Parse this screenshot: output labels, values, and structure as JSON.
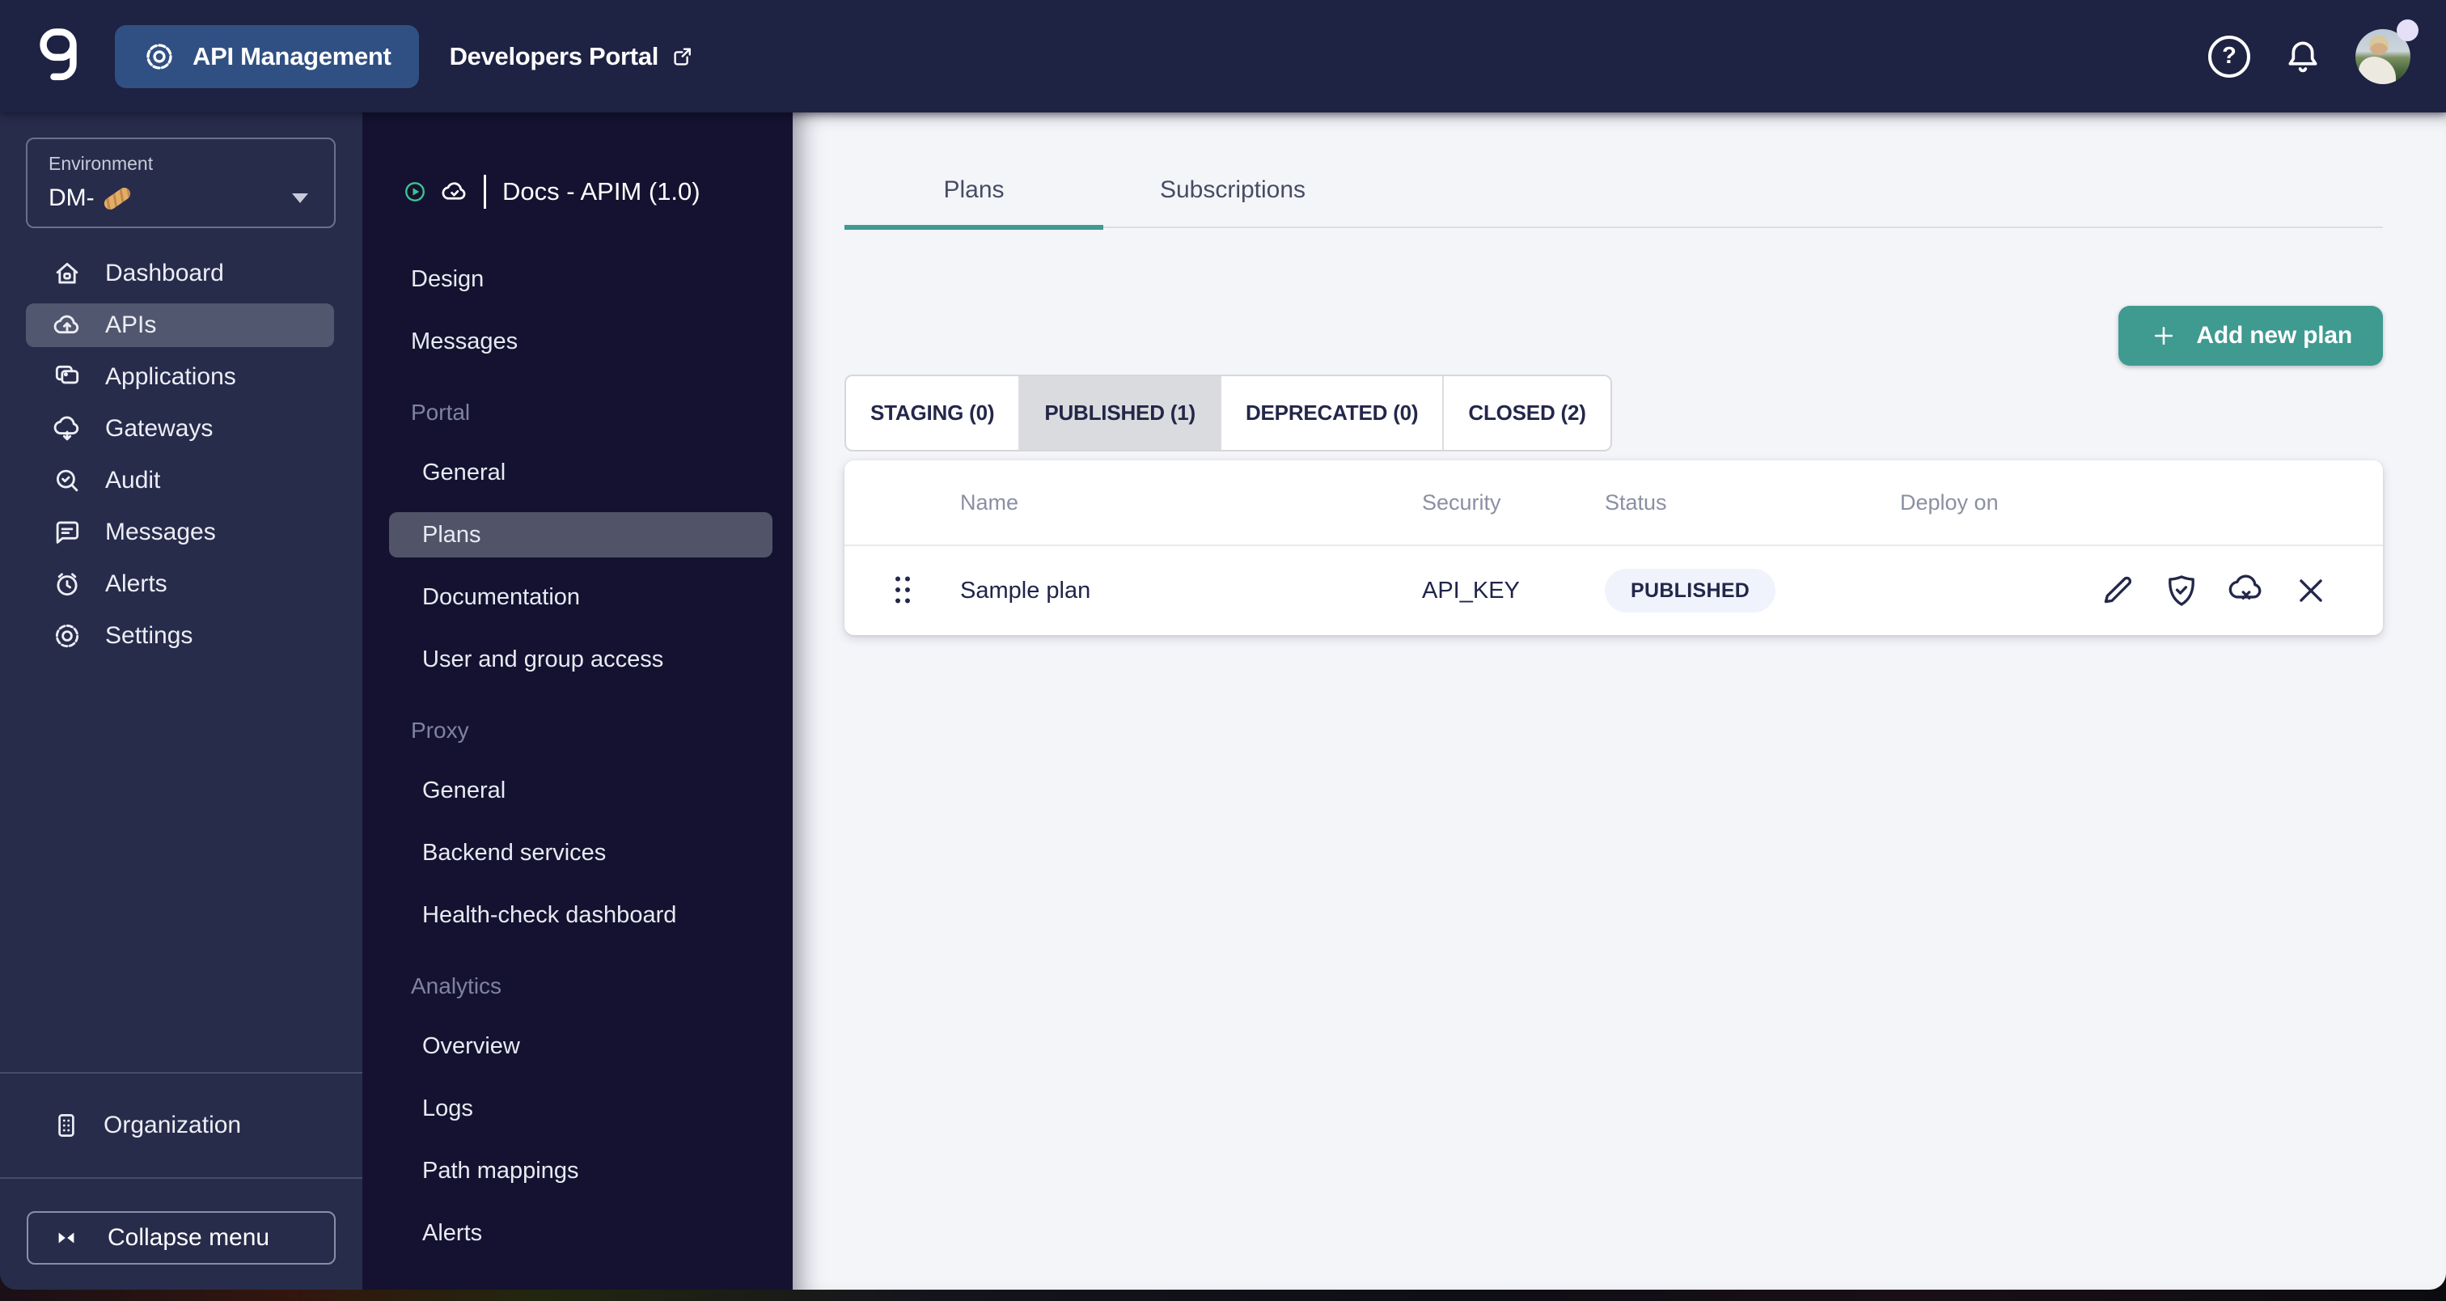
{
  "topbar": {
    "product_label": "API Management",
    "portal_label": "Developers Portal",
    "help_label": "?"
  },
  "env_sidebar": {
    "environment_label": "Environment",
    "environment_value": "DM-",
    "environment_value_icon": "baguette-emoji",
    "items": [
      {
        "label": "Dashboard",
        "icon": "home-icon",
        "active": false
      },
      {
        "label": "APIs",
        "icon": "cloud-up-icon",
        "active": true
      },
      {
        "label": "Applications",
        "icon": "applications-icon",
        "active": false
      },
      {
        "label": "Gateways",
        "icon": "cloud-down-icon",
        "active": false
      },
      {
        "label": "Audit",
        "icon": "search-check-icon",
        "active": false
      },
      {
        "label": "Messages",
        "icon": "chat-icon",
        "active": false
      },
      {
        "label": "Alerts",
        "icon": "alarm-icon",
        "active": false
      },
      {
        "label": "Settings",
        "icon": "gear-icon",
        "active": false
      }
    ],
    "organization_label": "Organization",
    "collapse_label": "Collapse menu"
  },
  "api_sidebar": {
    "title": "Docs - APIM (1.0)",
    "items": [
      {
        "label": "Design"
      },
      {
        "label": "Messages"
      },
      {
        "label": "Portal",
        "section": true
      },
      {
        "label": "General",
        "sub": true
      },
      {
        "label": "Plans",
        "sub": true,
        "active": true
      },
      {
        "label": "Documentation",
        "sub": true
      },
      {
        "label": "User and group access",
        "sub": true
      },
      {
        "label": "Proxy",
        "section": true
      },
      {
        "label": "General",
        "sub": true
      },
      {
        "label": "Backend services",
        "sub": true
      },
      {
        "label": "Health-check dashboard",
        "sub": true
      },
      {
        "label": "Analytics",
        "section": true
      },
      {
        "label": "Overview",
        "sub": true
      },
      {
        "label": "Logs",
        "sub": true
      },
      {
        "label": "Path mappings",
        "sub": true
      },
      {
        "label": "Alerts",
        "sub": true
      }
    ]
  },
  "main": {
    "tabs": [
      {
        "label": "Plans",
        "active": true
      },
      {
        "label": "Subscriptions",
        "active": false
      }
    ],
    "add_plan_button": {
      "label": "Add new plan",
      "icon": "plus-icon"
    },
    "status_filters": [
      {
        "label": "STAGING (0)",
        "selected": false
      },
      {
        "label": "PUBLISHED (1)",
        "selected": true
      },
      {
        "label": "DEPRECATED (0)",
        "selected": false
      },
      {
        "label": "CLOSED (2)",
        "selected": false
      }
    ],
    "plans_table": {
      "columns": [
        "Name",
        "Security",
        "Status",
        "Deploy on"
      ],
      "rows": [
        {
          "name": "Sample plan",
          "security": "API_KEY",
          "status": "PUBLISHED",
          "actions": [
            "edit-plan",
            "plan-design",
            "deprecate-plan",
            "close-plan"
          ]
        }
      ]
    }
  },
  "colors": {
    "accent_teal": "#3f9a90",
    "topbar_bg": "#1e2243",
    "env_sidebar_bg": "#272c4b",
    "api_sidebar_bg": "#141230",
    "main_bg": "#f4f5f9",
    "status_badge_bg": "#f1f3fc",
    "play_icon_green": "#3ec28f"
  }
}
